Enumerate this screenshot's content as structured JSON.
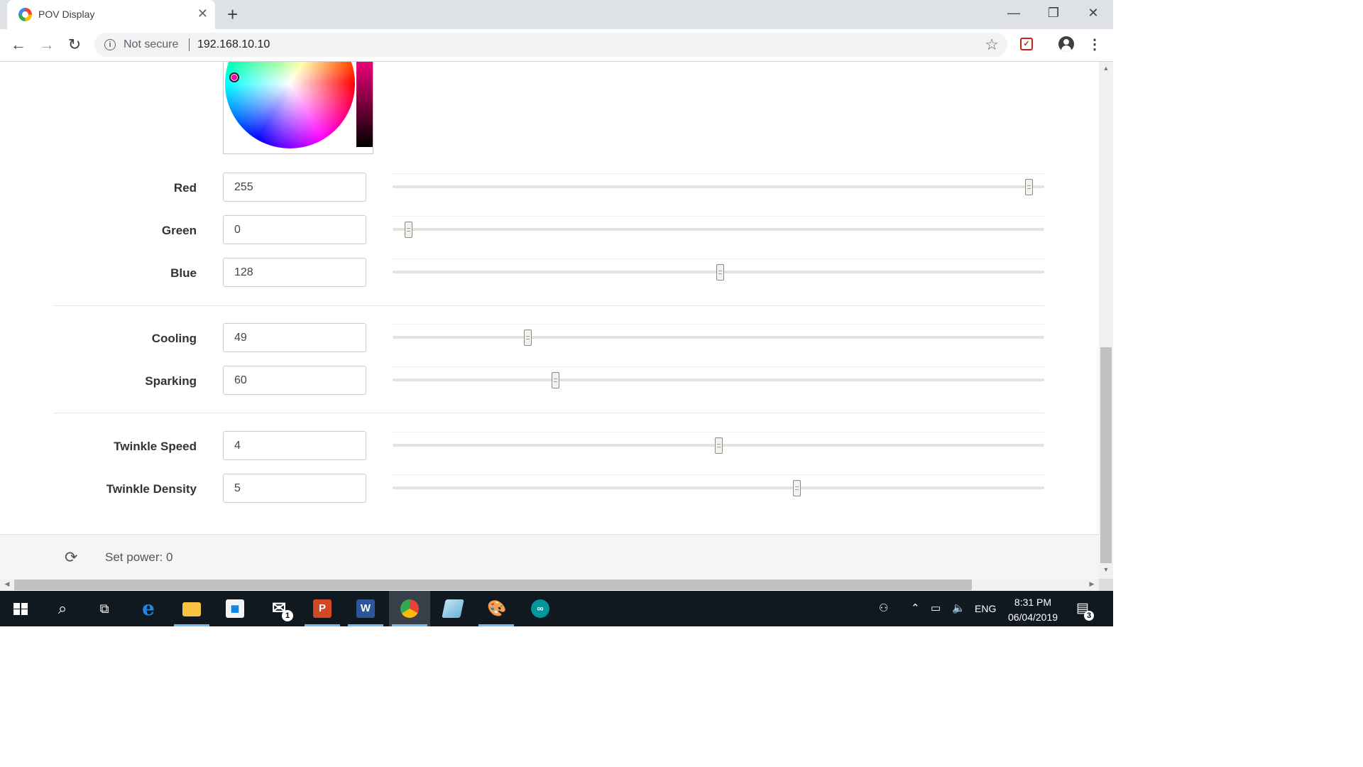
{
  "browser": {
    "tab_title": "POV Display",
    "tab_close": "✕",
    "new_tab": "+",
    "security_label": "Not secure",
    "url": "192.168.10.10",
    "window_controls": {
      "minimize": "—",
      "restore": "❐",
      "close": "✕"
    }
  },
  "color_picker": {
    "selected_color": "#ff0080"
  },
  "controls": {
    "red": {
      "label": "Red",
      "value": "255",
      "fraction": 0.976
    },
    "green": {
      "label": "Green",
      "value": "0",
      "fraction": 0.024
    },
    "blue": {
      "label": "Blue",
      "value": "128",
      "fraction": 0.502
    },
    "cooling": {
      "label": "Cooling",
      "value": "49",
      "fraction": 0.207
    },
    "sparking": {
      "label": "Sparking",
      "value": "60",
      "fraction": 0.249
    },
    "twinkle_speed": {
      "label": "Twinkle Speed",
      "value": "4",
      "fraction": 0.5
    },
    "twinkle_density": {
      "label": "Twinkle Density",
      "value": "5",
      "fraction": 0.62
    }
  },
  "footer": {
    "power_text": "Set power: 0"
  },
  "taskbar": {
    "mail_badge": "1",
    "language": "ENG",
    "time": "8:31 PM",
    "date": "06/04/2019",
    "notification_count": "3"
  },
  "icons": {
    "back": "back-arrow-icon",
    "forward": "forward-arrow-icon",
    "reload": "reload-icon",
    "info": "info-icon",
    "star": "bookmark-star-icon",
    "extension": "pocket-extension-icon",
    "profile": "profile-icon",
    "menu": "kebab-menu-icon",
    "refresh": "refresh-icon"
  }
}
